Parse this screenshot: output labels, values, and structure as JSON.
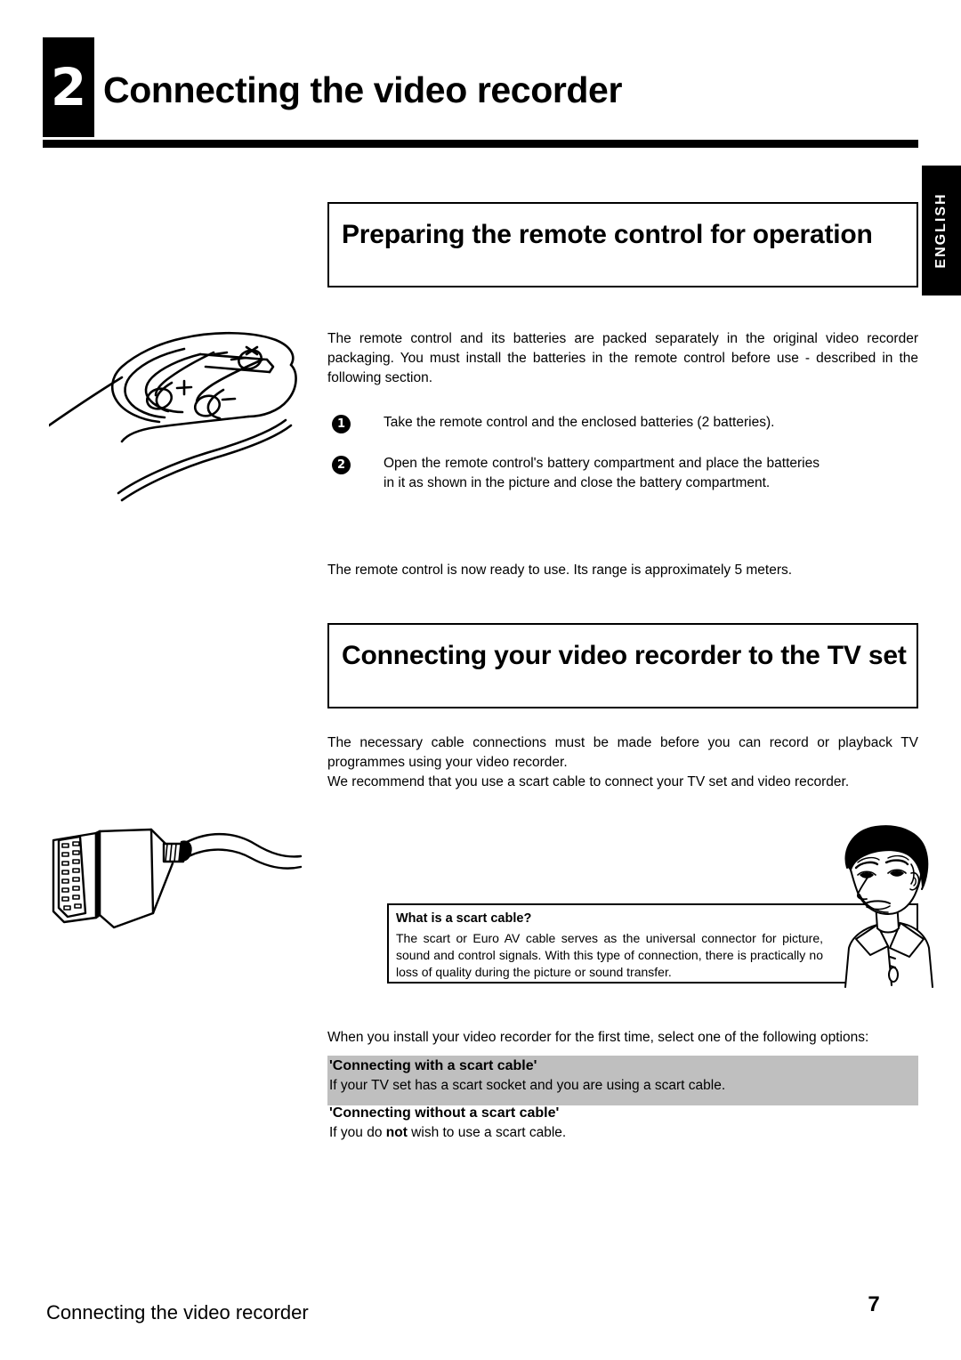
{
  "chapter": {
    "number": "2",
    "title": "Connecting the video recorder"
  },
  "side_tab": {
    "label": "ENGLISH"
  },
  "sections": [
    {
      "heading": "Preparing the remote control for operation",
      "intro": "The remote control and its batteries are packed separately in the original video recorder packaging. You must install the batteries in the remote control before use - described in the following section.",
      "steps": [
        {
          "number": "1",
          "text": "Take the remote control and the enclosed batteries (2 batteries)."
        },
        {
          "number": "2",
          "text": "Open the remote control's battery compartment and place the batteries in it as shown in the picture and close the battery compartment."
        }
      ],
      "outro": "The remote control is now ready to use. Its range is approximately 5 meters."
    },
    {
      "heading": "Connecting your video recorder to the TV set",
      "para1": "The necessary cable connections must be made before you can record or playback TV programmes using your video recorder.",
      "para2": "We recommend that you use a scart cable to connect your TV set and video recorder.",
      "info_box": {
        "title": "What is a scart cable?",
        "body": "The scart or Euro AV cable serves as the universal connector for picture, sound and control signals. With this type of connection, there is practically no loss of quality during the picture or sound transfer."
      },
      "options_intro": "When you install your video recorder for the first time, select one of the following options:",
      "options": [
        {
          "title": "'Connecting with a scart cable'",
          "desc": "If your TV set has a scart socket and you are using a scart cable.",
          "highlighted": true
        },
        {
          "title": "'Connecting without a scart cable'",
          "desc_pre": "If you do ",
          "desc_bold": "not",
          "desc_post": " wish to use a scart cable.",
          "highlighted": false
        }
      ]
    }
  ],
  "footer": {
    "running_title": "Connecting the video recorder",
    "page_number": "7"
  },
  "colors": {
    "ink": "#000000",
    "paper": "#ffffff",
    "highlight_band": "#bfbfbf"
  },
  "illustrations": {
    "remote": "remote-control-with-batteries-illustration",
    "scart": "scart-cable-connector-illustration",
    "man": "man-thinking-illustration"
  }
}
